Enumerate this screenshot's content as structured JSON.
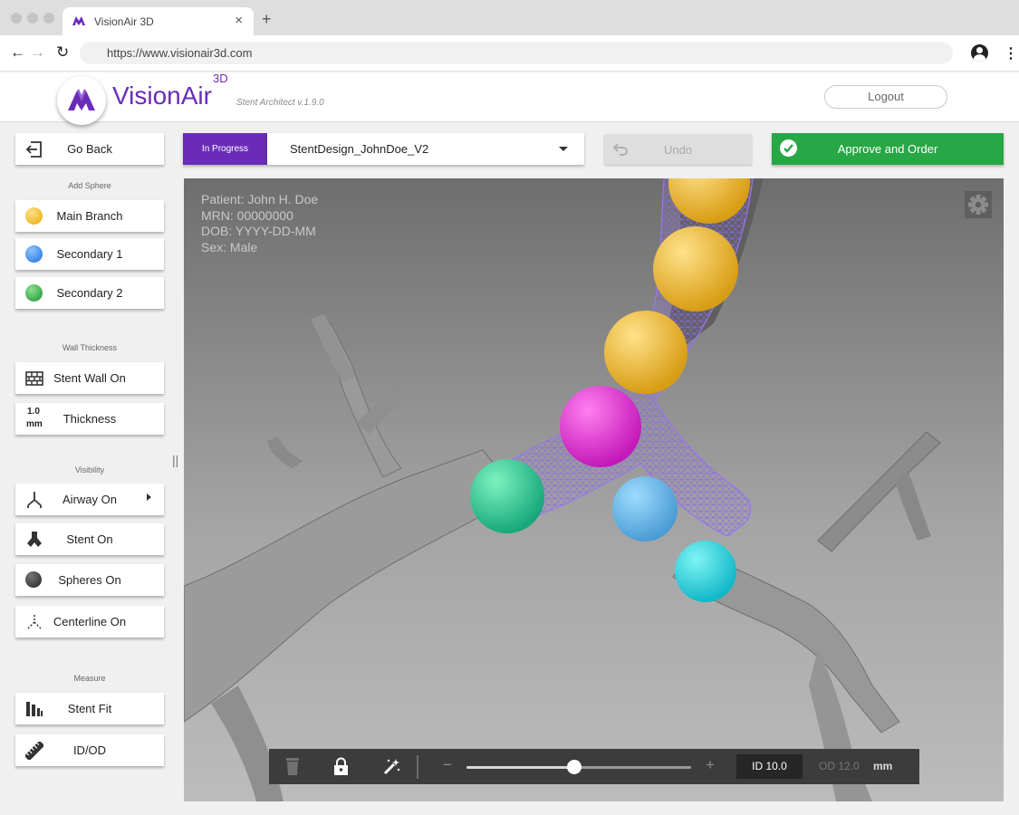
{
  "browser": {
    "tab_title": "VisionAir 3D",
    "tab_close": "×",
    "new_tab": "+",
    "url": "https://www.visionair3d.com"
  },
  "header": {
    "brand": "VisionAir",
    "brand_sup": "3D",
    "version": "Stent Architect v.1.9.0",
    "logout_label": "Logout"
  },
  "sidebar": {
    "go_back_label": "Go Back",
    "add_sphere_title": "Add Sphere",
    "spheres": [
      {
        "label": "Main Branch",
        "color": "#f2c037"
      },
      {
        "label": "Secondary 1",
        "color": "#2f86e8"
      },
      {
        "label": "Secondary 2",
        "color": "#27a83a"
      }
    ],
    "wall_thickness_title": "Wall Thickness",
    "stent_wall_label": "Stent Wall On",
    "thickness_value": "1.0",
    "thickness_unit": "mm",
    "thickness_label": "Thickness",
    "visibility_title": "Visibility",
    "airway_label": "Airway On",
    "stent_label": "Stent On",
    "spheres_label": "Spheres On",
    "centerline_label": "Centerline On",
    "measure_title": "Measure",
    "stent_fit_label": "Stent Fit",
    "idod_label": "ID/OD"
  },
  "topbar": {
    "status": "In Progress",
    "design_name": "StentDesign_JohnDoe_V2",
    "undo_label": "Undo",
    "approve_label": "Approve and Order",
    "colors": {
      "status": "#6a2cb8",
      "approve": "#27a745"
    }
  },
  "patient": {
    "name": "Patient: John H. Doe",
    "mrn": "MRN: 00000000",
    "dob": "DOB: YYYY-DD-MM",
    "sex": "Sex: Male"
  },
  "toolbar": {
    "minus": "−",
    "plus": "+",
    "slider_value": 0.48,
    "id_text": "ID 10.0",
    "od_text": "OD 12.0",
    "unit": "mm"
  }
}
